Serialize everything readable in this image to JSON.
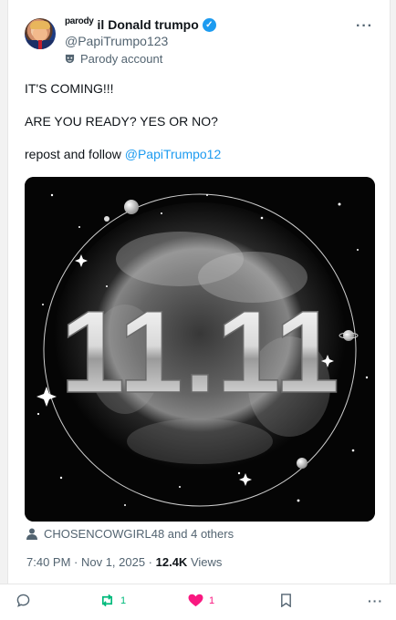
{
  "post": {
    "parody_tag": "parody",
    "display_name": "il Donald trumpo",
    "handle": "@PapiTrumpo123",
    "account_label": "Parody account",
    "line1": "IT'S COMING!!!",
    "line2": "ARE YOU READY? YES OR NO?",
    "line3_prefix": "repost and follow ",
    "mention": "@PapiTrumpo12",
    "image_text": "11.11",
    "reposted_by": "CHOSENCOWGIRL48 and 4 others",
    "time": "7:40 PM · Nov 1, 2025 · ",
    "views_count": "12.4K",
    "views_label": " Views"
  },
  "actions": {
    "reply_count": "",
    "repost_count": "1",
    "like_count": "1"
  },
  "colors": {
    "accent": "#1d9bf0",
    "repost_green": "#00ba7c",
    "like_pink": "#f91880",
    "muted": "#536471"
  },
  "icons": [
    "avatar",
    "verified-icon",
    "parody-mask-icon",
    "more-icon",
    "person-icon",
    "reply-icon",
    "repost-icon",
    "like-icon",
    "bookmark-icon",
    "more-actions-icon"
  ]
}
